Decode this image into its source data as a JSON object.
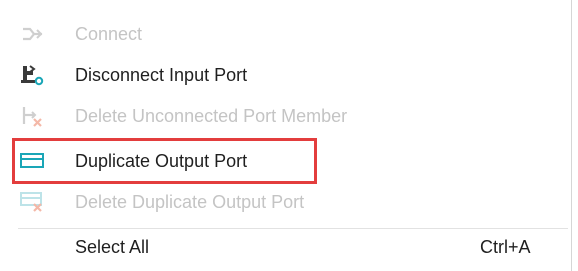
{
  "menu": {
    "items": [
      {
        "label": "Connect",
        "icon": "connect-icon",
        "enabled": false,
        "shortcut": ""
      },
      {
        "label": "Disconnect Input Port",
        "icon": "disconnect-input-port-icon",
        "enabled": true,
        "shortcut": ""
      },
      {
        "label": "Delete Unconnected Port Member",
        "icon": "delete-port-member-icon",
        "enabled": false,
        "shortcut": ""
      },
      {
        "label": "Duplicate Output Port",
        "icon": "duplicate-output-port-icon",
        "enabled": true,
        "shortcut": "",
        "highlighted": true
      },
      {
        "label": "Delete Duplicate Output Port",
        "icon": "delete-duplicate-port-icon",
        "enabled": false,
        "shortcut": ""
      },
      {
        "label": "Select All",
        "icon": "",
        "enabled": true,
        "shortcut": "Ctrl+A"
      }
    ]
  },
  "colors": {
    "highlight_border": "#e33d3d",
    "icon_teal": "#1aa6b7",
    "icon_red": "#f07a5c",
    "disabled_text": "#c4c4c4"
  }
}
